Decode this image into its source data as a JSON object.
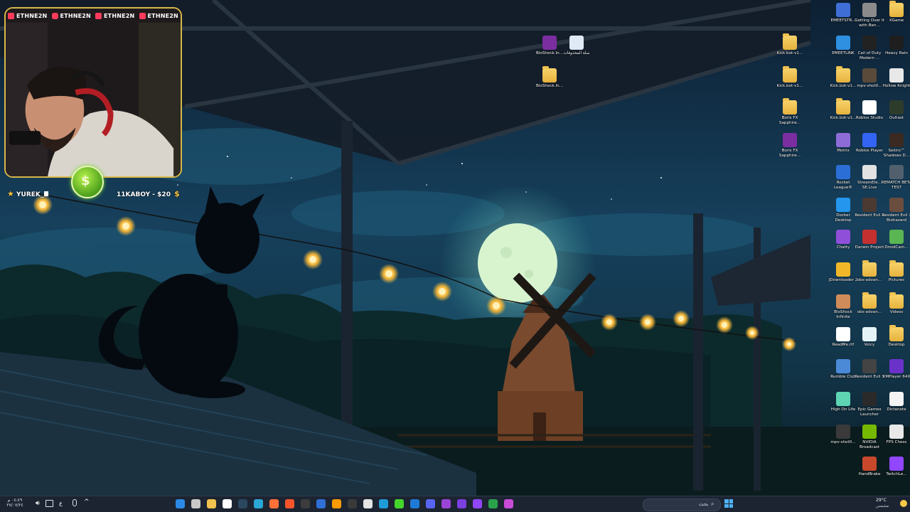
{
  "stream": {
    "social_handles": [
      "ETHNE2N",
      "ETHNE2N",
      "ETHNE2N",
      "ETHNE2N"
    ],
    "social_colors": [
      "#ff3b5c",
      "#ff3b5c",
      "#ff3b5c",
      "#ff3b5c"
    ],
    "top_supporter": "YUREK_",
    "donation": "11KABOY - $20",
    "badge_symbol": "$"
  },
  "desktop_icons_left": [
    {
      "label": "BioShock.In...",
      "icon": "archive-icon",
      "color": "#7a2ea0"
    },
    {
      "label": "سلة المحذوفات",
      "icon": "recycle-bin-icon",
      "color": "#dfe9f5"
    },
    {
      "label": "BioShock.In...",
      "icon": "folder-icon",
      "color": "#f1c24e"
    }
  ],
  "desktop_icons_right": [
    {
      "label": "EMEETSTR...",
      "icon": "emeet-icon",
      "color": "#3f6fd6"
    },
    {
      "label": "Getting Over It with Ben...",
      "icon": "game-icon",
      "color": "#8b8b8b"
    },
    {
      "label": "XGame",
      "icon": "folder-icon",
      "color": "#f1c24e"
    },
    {
      "label": "Kick.bot-v1...",
      "icon": "folder-icon",
      "color": "#f1c24e"
    },
    {
      "label": "EMEETLINK",
      "icon": "emeet-link-icon",
      "color": "#2f8fe0"
    },
    {
      "label": "Call of Duty Modern ...",
      "icon": "cod-icon",
      "color": "#222222"
    },
    {
      "label": "Heavy Rain",
      "icon": "heavy-rain-icon",
      "color": "#1e1e1e"
    },
    {
      "label": "Kick.bot-v1...",
      "icon": "folder-icon",
      "color": "#f1c24e"
    },
    {
      "label": "Kick.bot-v1...",
      "icon": "folder-icon",
      "color": "#f1c24e"
    },
    {
      "label": "mpv-shot0...",
      "icon": "image-icon",
      "color": "#5a4a3a"
    },
    {
      "label": "Hollow Knight",
      "icon": "hollow-knight-icon",
      "color": "#e8e8e8"
    },
    {
      "label": "Boris FX Sapphire...",
      "icon": "folder-icon",
      "color": "#f1c24e"
    },
    {
      "label": "Kick.bot-v1...",
      "icon": "folder-icon",
      "color": "#f1c24e"
    },
    {
      "label": "Roblox Studio",
      "icon": "roblox-studio-icon",
      "color": "#ffffff"
    },
    {
      "label": "Outlast",
      "icon": "outlast-icon",
      "color": "#2d3b2a"
    },
    {
      "label": "Boris FX Sapphire...",
      "icon": "archive-icon",
      "color": "#7a2ea0"
    },
    {
      "label": "Motrix",
      "icon": "motrix-icon",
      "color": "#8e6cd8"
    },
    {
      "label": "Roblox Player",
      "icon": "roblox-icon",
      "color": "#3364f3"
    },
    {
      "label": "Sekiro™ Shadows D...",
      "icon": "sekiro-icon",
      "color": "#3a2a22"
    },
    {
      "label": "Rocket League®",
      "icon": "rocket-league-icon",
      "color": "#2b6fd6"
    },
    {
      "label": "StreamEle... SE.Live",
      "icon": "streamelements-icon",
      "color": "#e2e2e2"
    },
    {
      "label": "REMATCH BETA TEST",
      "icon": "rematch-icon",
      "color": "#52606e"
    },
    {
      "label": "Docker Desktop",
      "icon": "docker-icon",
      "color": "#2496ed"
    },
    {
      "label": "Resident Evil 2",
      "icon": "re2-icon",
      "color": "#4a3a32"
    },
    {
      "label": "Resident Evil 7 Biohazard",
      "icon": "re7-icon",
      "color": "#6a4d3e"
    },
    {
      "label": "Chatty",
      "icon": "chatty-icon",
      "color": "#8f4fd8"
    },
    {
      "label": "Darwin Project",
      "icon": "darwin-icon",
      "color": "#c43030"
    },
    {
      "label": "DroidCam...",
      "icon": "droidcam-icon",
      "color": "#5ab552"
    },
    {
      "label": "JDownloader 2",
      "icon": "jdownloader-icon",
      "color": "#f0b828"
    },
    {
      "label": "obs-advan...",
      "icon": "folder-icon",
      "color": "#f1c24e"
    },
    {
      "label": "Pictures",
      "icon": "folder-icon",
      "color": "#f1c24e"
    },
    {
      "label": "BioShock Infinite",
      "icon": "bioshock-icon",
      "color": "#cf8b5a"
    },
    {
      "label": "obs-advan...",
      "icon": "folder-icon",
      "color": "#f1c24e"
    },
    {
      "label": "Videos",
      "icon": "folder-icon",
      "color": "#f1c24e"
    },
    {
      "label": "ReadMe.rtf",
      "icon": "document-icon",
      "color": "#ffffff"
    },
    {
      "label": "Voicy",
      "icon": "voicy-icon",
      "color": "#e4f4f6"
    },
    {
      "label": "Desktop",
      "icon": "folder-icon",
      "color": "#f1c24e"
    },
    {
      "label": "Rumble Club",
      "icon": "rumble-icon",
      "color": "#4b8ad6"
    },
    {
      "label": "Resident Evil 3",
      "icon": "re3-icon",
      "color": "#444444"
    },
    {
      "label": "KMPlayer 64X",
      "icon": "kmplayer-icon",
      "color": "#6a32c8"
    },
    {
      "label": "High On Life",
      "icon": "high-on-life-icon",
      "color": "#5ed4b2"
    },
    {
      "label": "Epic Games Launcher",
      "icon": "epic-icon",
      "color": "#2a2a2a"
    },
    {
      "label": "Dictanote",
      "icon": "dictanote-icon",
      "color": "#f4f4f4"
    },
    {
      "label": "mpv-shot0...",
      "icon": "image-icon",
      "color": "#3a3a3a"
    },
    {
      "label": "NVIDIA Broadcast",
      "icon": "nvidia-icon",
      "color": "#76b900"
    },
    {
      "label": "FPS Chess",
      "icon": "chess-icon",
      "color": "#e8e8e8"
    },
    {
      "label": "HandBrake",
      "icon": "handbrake-icon",
      "color": "#c8482c"
    },
    {
      "label": "TwitchLe...",
      "icon": "twitch-icon",
      "color": "#9146ff"
    }
  ],
  "taskbar": {
    "search_placeholder": "بحث",
    "weather_temp": "29°C",
    "weather_desc": "مشمس",
    "time": "٠٤:٤٩ م",
    "date": "٢٧/٠٧/٢٤",
    "lang": "ع",
    "pinned_icons": [
      {
        "name": "start-icon",
        "color": "#2b8ae6"
      },
      {
        "name": "taskview-icon",
        "color": "#c8c8c8"
      },
      {
        "name": "files-icon",
        "color": "#f1c24e"
      },
      {
        "name": "camera-icon",
        "color": "#ffffff"
      },
      {
        "name": "steam-icon",
        "color": "#2a475e"
      },
      {
        "name": "edge-icon",
        "color": "#29a6d6"
      },
      {
        "name": "firefox-icon",
        "color": "#ff7139"
      },
      {
        "name": "brave-icon",
        "color": "#fb542b"
      },
      {
        "name": "obs-icon",
        "color": "#3c3c3c"
      },
      {
        "name": "app-icon",
        "color": "#2f6fd6"
      },
      {
        "name": "illustrator-icon",
        "color": "#ff9a00"
      },
      {
        "name": "video-icon",
        "color": "#3a3a3a"
      },
      {
        "name": "notes-icon",
        "color": "#e4e4e4"
      },
      {
        "name": "sheets-icon",
        "color": "#1f9bd6"
      },
      {
        "name": "kick-icon",
        "color": "#44d62c"
      },
      {
        "name": "vs-icon",
        "color": "#1e7ad6"
      },
      {
        "name": "discord-icon",
        "color": "#5865f2"
      },
      {
        "name": "app2-icon",
        "color": "#9a44d6"
      },
      {
        "name": "app3-icon",
        "color": "#7c3fe0"
      },
      {
        "name": "twitch-icon",
        "color": "#9146ff"
      },
      {
        "name": "chrome-icon",
        "color": "#2ba24c"
      },
      {
        "name": "app4-icon",
        "color": "#c94bd6"
      }
    ]
  }
}
